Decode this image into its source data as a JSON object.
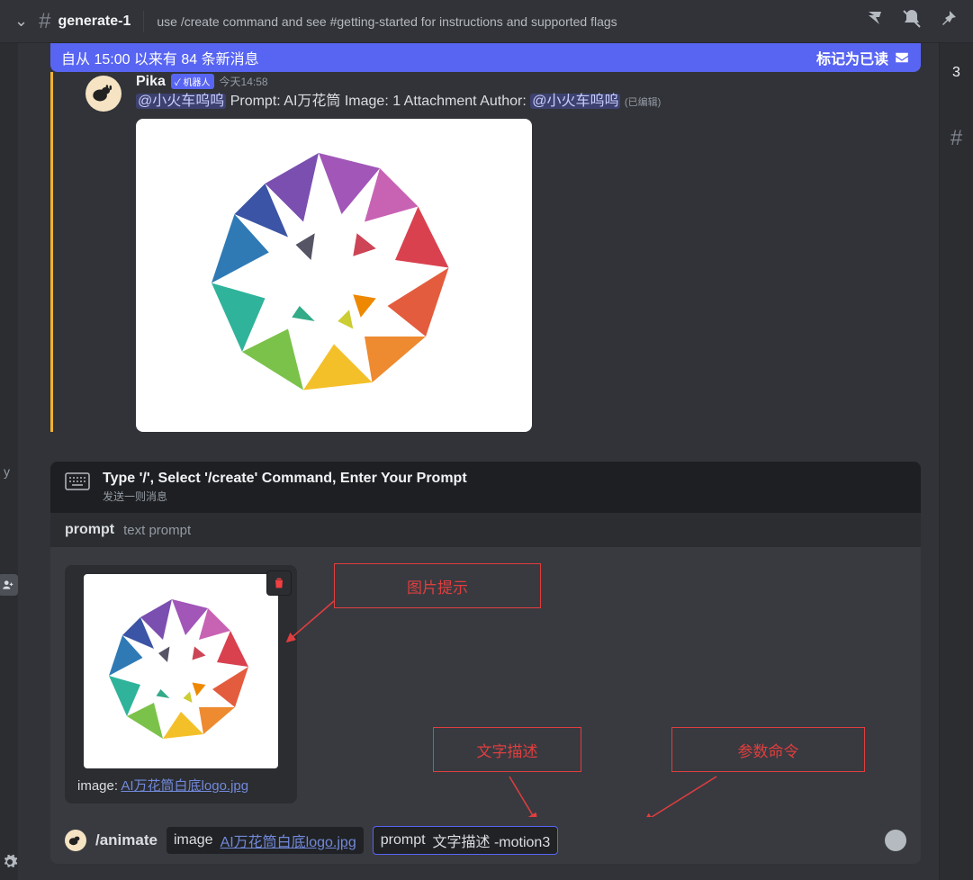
{
  "header": {
    "channel": "generate-1",
    "topic": "use /create command and see #getting-started for instructions and supported flags"
  },
  "right_strip": {
    "count": "3"
  },
  "left_strip": {
    "label": "y"
  },
  "banner": {
    "text": "自从 15:00 以来有 84 条新消息",
    "mark_read": "标记为已读"
  },
  "message": {
    "author": "Pika",
    "bot_tag": "✓ 机器人",
    "timestamp": "今天14:58",
    "mention": "@小火车呜呜",
    "prompt_label": " Prompt: ",
    "prompt_value": "AI万花筒",
    "image_label": "  Image: ",
    "image_value": "1 Attachment",
    "author_label": "  Author: ",
    "author_mention": "@小火车呜呜",
    "edited": "(已编辑)"
  },
  "slash_panel": {
    "title": "Type '/', Select '/create' Command, Enter Your Prompt",
    "subtitle": "发送一则消息",
    "prompt_label": "prompt",
    "prompt_desc": "text prompt"
  },
  "upload": {
    "caption_prefix": "image: ",
    "filename": "AI万花筒白底logo.jpg"
  },
  "annotations": {
    "image_hint": "图片提示",
    "text_desc": "文字描述",
    "param_cmd": "参数命令"
  },
  "input": {
    "command": "/animate",
    "image_label": "image",
    "image_file": "AI万花筒白底logo.jpg",
    "prompt_label": "prompt",
    "prompt_value": "文字描述  -motion3"
  }
}
